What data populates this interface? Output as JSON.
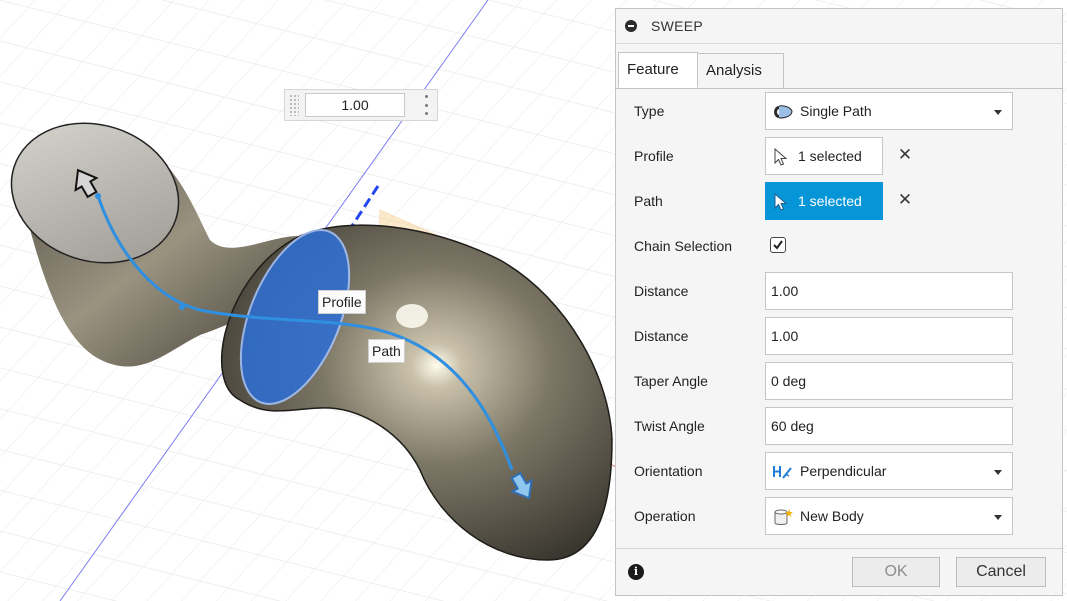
{
  "viewport": {
    "dimension_input_value": "1.00",
    "labels": {
      "profile": "Profile",
      "path": "Path"
    }
  },
  "dialog": {
    "title": "SWEEP",
    "tabs": [
      {
        "label": "Feature",
        "active": true
      },
      {
        "label": "Analysis",
        "active": false
      }
    ],
    "type": {
      "label": "Type",
      "value": "Single Path",
      "icon": "single-path-icon"
    },
    "profile": {
      "label": "Profile",
      "value": "1 selected",
      "icon": "cursor-icon"
    },
    "path": {
      "label": "Path",
      "value": "1 selected",
      "active": true,
      "icon": "cursor-icon"
    },
    "chain_selection": {
      "label": "Chain Selection",
      "checked": true
    },
    "distance_1": {
      "label": "Distance",
      "value": "1.00"
    },
    "distance_2": {
      "label": "Distance",
      "value": "1.00"
    },
    "taper_angle": {
      "label": "Taper Angle",
      "value": "0 deg"
    },
    "twist_angle": {
      "label": "Twist Angle",
      "value": "60 deg"
    },
    "orientation": {
      "label": "Orientation",
      "value": "Perpendicular",
      "icon": "perpendicular-icon"
    },
    "operation": {
      "label": "Operation",
      "value": "New Body",
      "icon": "new-body-icon"
    },
    "buttons": {
      "ok": "OK",
      "cancel": "Cancel"
    }
  },
  "colors": {
    "accent": "#0696d7",
    "path_curve": "#2f8fe0",
    "profile_fill": "#2d6fd6",
    "body": "#7a7465"
  }
}
